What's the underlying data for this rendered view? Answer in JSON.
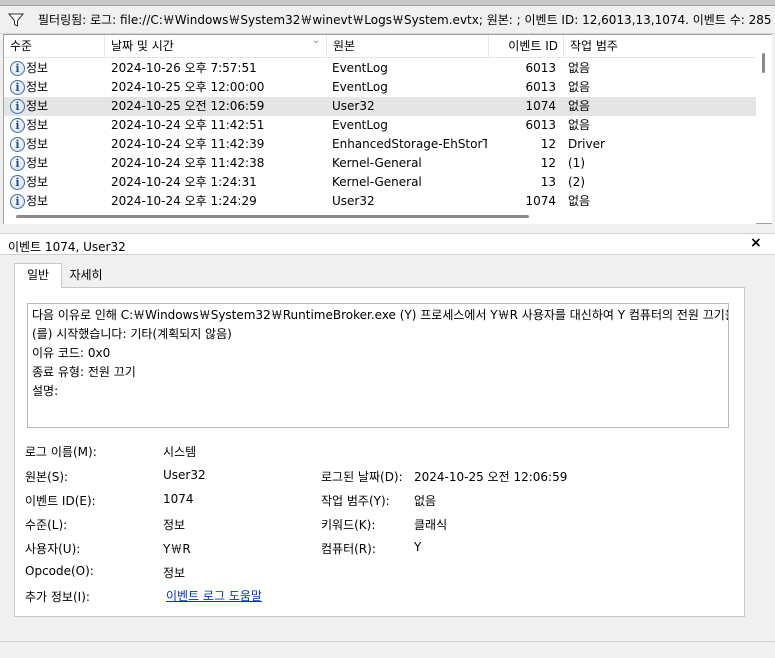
{
  "filter": {
    "icon": "filter-icon",
    "text": "필터링됨: 로그: file://C:￦Windows￦System32￦winevt￦Logs￦System.evtx; 원본: ; 이벤트 ID: 12,6013,13,1074. 이벤트 수: 285"
  },
  "table": {
    "headers": {
      "level": "수준",
      "datetime": "날짜 및 시간",
      "source": "원본",
      "event_id": "이벤트 ID",
      "category": "작업 범주"
    },
    "rows": [
      {
        "level": "정보",
        "datetime": "2024-10-26 오후 7:57:51",
        "source": "EventLog",
        "event_id": "6013",
        "category": "없음"
      },
      {
        "level": "정보",
        "datetime": "2024-10-25 오후 12:00:00",
        "source": "EventLog",
        "event_id": "6013",
        "category": "없음"
      },
      {
        "level": "정보",
        "datetime": "2024-10-25 오전 12:06:59",
        "source": "User32",
        "event_id": "1074",
        "category": "없음"
      },
      {
        "level": "정보",
        "datetime": "2024-10-24 오후 11:42:51",
        "source": "EventLog",
        "event_id": "6013",
        "category": "없음"
      },
      {
        "level": "정보",
        "datetime": "2024-10-24 오후 11:42:39",
        "source": "EnhancedStorage-EhStorT...",
        "event_id": "12",
        "category": "Driver"
      },
      {
        "level": "정보",
        "datetime": "2024-10-24 오후 11:42:38",
        "source": "Kernel-General",
        "event_id": "12",
        "category": "(1)"
      },
      {
        "level": "정보",
        "datetime": "2024-10-24 오후 1:24:31",
        "source": "Kernel-General",
        "event_id": "13",
        "category": "(2)"
      },
      {
        "level": "정보",
        "datetime": "2024-10-24 오후 1:24:29",
        "source": "User32",
        "event_id": "1074",
        "category": "없음"
      }
    ],
    "selected_row": 2
  },
  "detail": {
    "title": "이벤트 1074, User32",
    "close": "×",
    "tabs": [
      "일반",
      "자세히"
    ],
    "description": [
      "다음 이유로 인해 C:￦Windows￦System32￦RuntimeBroker.exe (Y) 프로세스에서 Y￦R 사용자를 대신하여 Y 컴퓨터의 전원 끄기을",
      "(를) 시작했습니다: 기타(계획되지 않음)",
      "이유 코드: 0x0",
      "종료 유형: 전원 끄기",
      "설명:"
    ],
    "fields": {
      "log_name_label": "로그 이름(M):",
      "log_name_value": "시스템",
      "source_label": "원본(S):",
      "source_value": "User32",
      "logged_label": "로그된 날짜(D):",
      "logged_value": "2024-10-25 오전 12:06:59",
      "event_id_label": "이벤트 ID(E):",
      "event_id_value": "1074",
      "task_label": "작업 범주(Y):",
      "task_value": "없음",
      "level_label": "수준(L):",
      "level_value": "정보",
      "keywords_label": "키워드(K):",
      "keywords_value": "클래식",
      "user_label": "사용자(U):",
      "user_value": "Y￦R",
      "computer_label": "컴퓨터(R):",
      "computer_value": "Y",
      "opcode_label": "Opcode(O):",
      "opcode_value": "정보",
      "more_info_label": "추가 정보(I):",
      "more_info_link": "이벤트 로그 도움말"
    }
  },
  "colors": {
    "selected_row": "#e5e5e5",
    "link": "#0033cc",
    "info_icon_border": "#3a6ea5"
  }
}
